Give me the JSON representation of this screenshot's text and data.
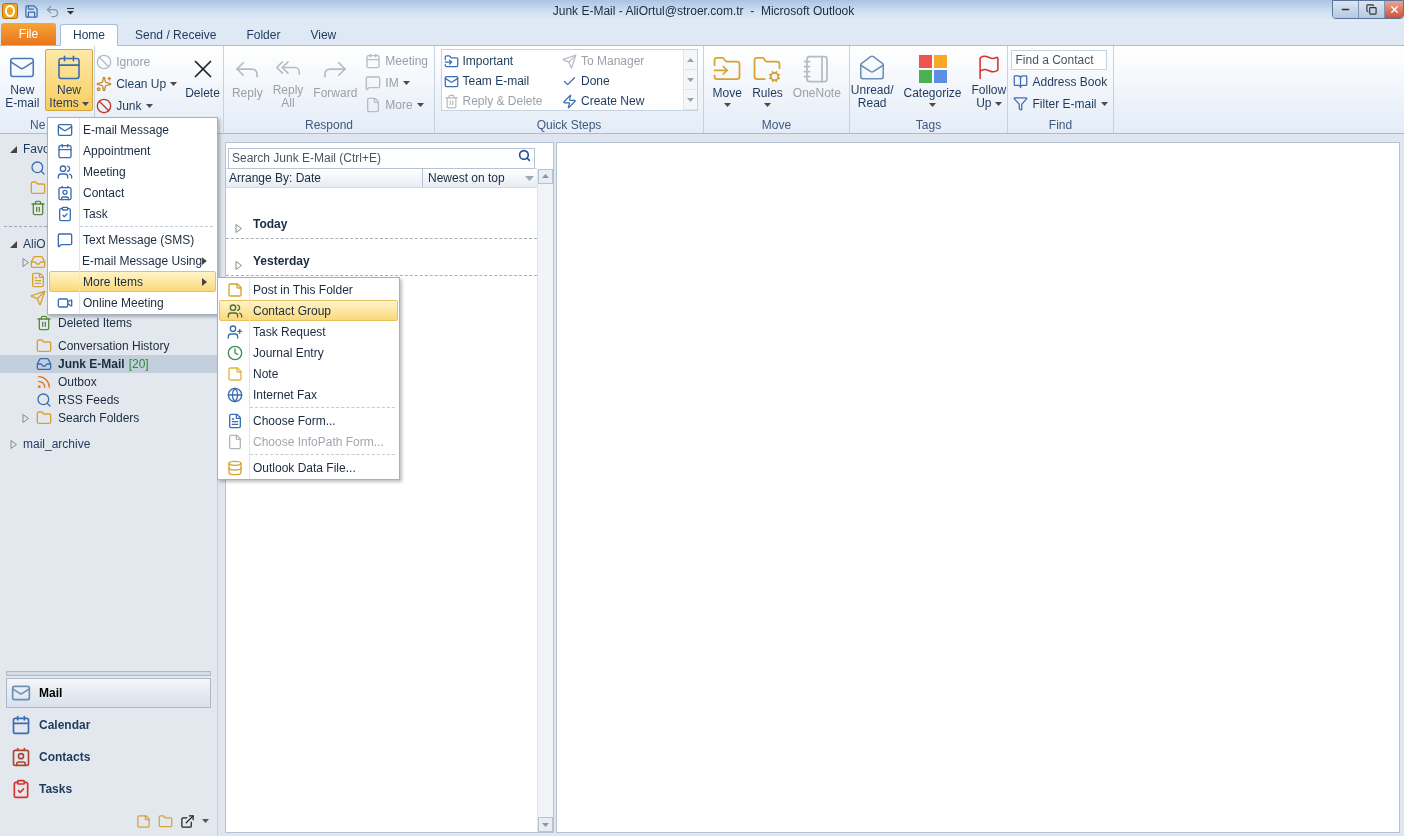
{
  "window": {
    "title": "Junk E-Mail - AliOrtul@stroer.com.tr  -  Microsoft Outlook"
  },
  "tabs": [
    {
      "label": "File",
      "kind": "backstage",
      "selected": false
    },
    {
      "label": "Home",
      "kind": "tab",
      "selected": true
    },
    {
      "label": "Send / Receive",
      "kind": "tab",
      "selected": false
    },
    {
      "label": "Folder",
      "kind": "tab",
      "selected": false
    },
    {
      "label": "View",
      "kind": "tab",
      "selected": false
    }
  ],
  "ribbon": {
    "new": {
      "label": "Ne",
      "buttons": [
        {
          "lines": [
            "New",
            "E-mail"
          ],
          "pressed": false,
          "dropdown": false
        },
        {
          "lines": [
            "New",
            "Items"
          ],
          "pressed": true,
          "dropdown": true
        }
      ]
    },
    "delete": {
      "small": [
        {
          "label": "Ignore",
          "disabled": true,
          "dropdown": false
        },
        {
          "label": "Clean Up",
          "disabled": false,
          "dropdown": true
        },
        {
          "label": "Junk",
          "disabled": false,
          "dropdown": true
        }
      ],
      "large": {
        "lines": [
          "Delete"
        ],
        "disabled": false
      }
    },
    "respond": {
      "label": "Respond",
      "large": [
        {
          "lines": [
            "Reply"
          ],
          "disabled": true
        },
        {
          "lines": [
            "Reply",
            "All"
          ],
          "disabled": true
        },
        {
          "lines": [
            "Forward"
          ],
          "disabled": true
        }
      ],
      "small": [
        {
          "label": "Meeting",
          "disabled": true,
          "dropdown": false
        },
        {
          "label": "IM",
          "disabled": true,
          "dropdown": true
        },
        {
          "label": "More",
          "disabled": true,
          "dropdown": true
        }
      ]
    },
    "quick_steps": {
      "label": "Quick Steps",
      "items": [
        {
          "label": "Important",
          "disabled": false
        },
        {
          "label": "To Manager",
          "disabled": true
        },
        {
          "label": "Team E-mail",
          "disabled": false
        },
        {
          "label": "Done",
          "disabled": false
        },
        {
          "label": "Reply & Delete",
          "disabled": true
        },
        {
          "label": "Create New",
          "disabled": false
        }
      ]
    },
    "move": {
      "label": "Move",
      "buttons": [
        {
          "lines": [
            "Move"
          ],
          "disabled": false,
          "dropdown": true
        },
        {
          "lines": [
            "Rules"
          ],
          "disabled": false,
          "dropdown": true
        },
        {
          "lines": [
            "OneNote"
          ],
          "disabled": true,
          "dropdown": false
        }
      ]
    },
    "tags": {
      "label": "Tags",
      "buttons": [
        {
          "lines": [
            "Unread/",
            "Read"
          ],
          "disabled": false,
          "dropdown": false
        },
        {
          "lines": [
            "Categorize"
          ],
          "disabled": false,
          "dropdown": true
        },
        {
          "lines": [
            "Follow",
            "Up"
          ],
          "disabled": false,
          "dropdown": true
        }
      ]
    },
    "find": {
      "label": "Find",
      "search": {
        "placeholder": "Find a Contact"
      },
      "items": [
        {
          "label": "Address Book",
          "dropdown": false
        },
        {
          "label": "Filter E-mail",
          "dropdown": true
        }
      ]
    }
  },
  "sidebar": {
    "favorites": {
      "label": "Favo",
      "expanded": true
    },
    "account": {
      "label": "AliO",
      "expanded": true,
      "folders": [
        {
          "name": "Deleted Items",
          "selected": false
        },
        {
          "name": "Conversation History",
          "selected": false
        },
        {
          "name": "Junk E-Mail",
          "count": "[20]",
          "selected": true
        },
        {
          "name": "Outbox",
          "selected": false
        },
        {
          "name": "RSS Feeds",
          "selected": false
        },
        {
          "name": "Search Folders",
          "selected": false,
          "expanded": false
        }
      ]
    },
    "archive": {
      "label": "mail_archive",
      "expanded": false
    },
    "nav": [
      {
        "label": "Mail",
        "selected": true
      },
      {
        "label": "Calendar",
        "selected": false
      },
      {
        "label": "Contacts",
        "selected": false
      },
      {
        "label": "Tasks",
        "selected": false
      }
    ]
  },
  "message_list": {
    "search": {
      "placeholder": "Search Junk E-Mail (Ctrl+E)"
    },
    "arrange": "Arrange By: Date",
    "order": "Newest on top",
    "groups": [
      {
        "label": "Today",
        "expanded": false
      },
      {
        "label": "Yesterday",
        "expanded": false
      }
    ]
  },
  "new_items_menu": {
    "items": [
      {
        "label": "E-mail Message",
        "divider": false,
        "submenu": false,
        "selected": false
      },
      {
        "label": "Appointment",
        "divider": false,
        "submenu": false,
        "selected": false
      },
      {
        "label": "Meeting",
        "divider": false,
        "submenu": false,
        "selected": false
      },
      {
        "label": "Contact",
        "divider": false,
        "submenu": false,
        "selected": false
      },
      {
        "label": "Task",
        "divider": false,
        "submenu": false,
        "selected": false
      },
      {
        "label": "Text Message (SMS)",
        "divider": true,
        "submenu": false,
        "selected": false
      },
      {
        "label": "E-mail Message Using",
        "divider": false,
        "submenu": true,
        "selected": false
      },
      {
        "label": "More Items",
        "divider": false,
        "submenu": true,
        "selected": true
      },
      {
        "label": "Online Meeting",
        "divider": false,
        "submenu": false,
        "selected": false
      }
    ]
  },
  "more_items_menu": {
    "items": [
      {
        "label": "Post in This Folder",
        "divider": false,
        "disabled": false,
        "selected": false
      },
      {
        "label": "Contact Group",
        "divider": false,
        "disabled": false,
        "selected": true
      },
      {
        "label": "Task Request",
        "divider": false,
        "disabled": false,
        "selected": false
      },
      {
        "label": "Journal Entry",
        "divider": false,
        "disabled": false,
        "selected": false
      },
      {
        "label": "Note",
        "divider": false,
        "disabled": false,
        "selected": false
      },
      {
        "label": "Internet Fax",
        "divider": false,
        "disabled": false,
        "selected": false
      },
      {
        "label": "Choose Form...",
        "divider": true,
        "disabled": false,
        "selected": false
      },
      {
        "label": "Choose InfoPath Form...",
        "divider": false,
        "disabled": true,
        "selected": false
      },
      {
        "label": "Outlook Data File...",
        "divider": true,
        "disabled": false,
        "selected": false
      }
    ]
  }
}
